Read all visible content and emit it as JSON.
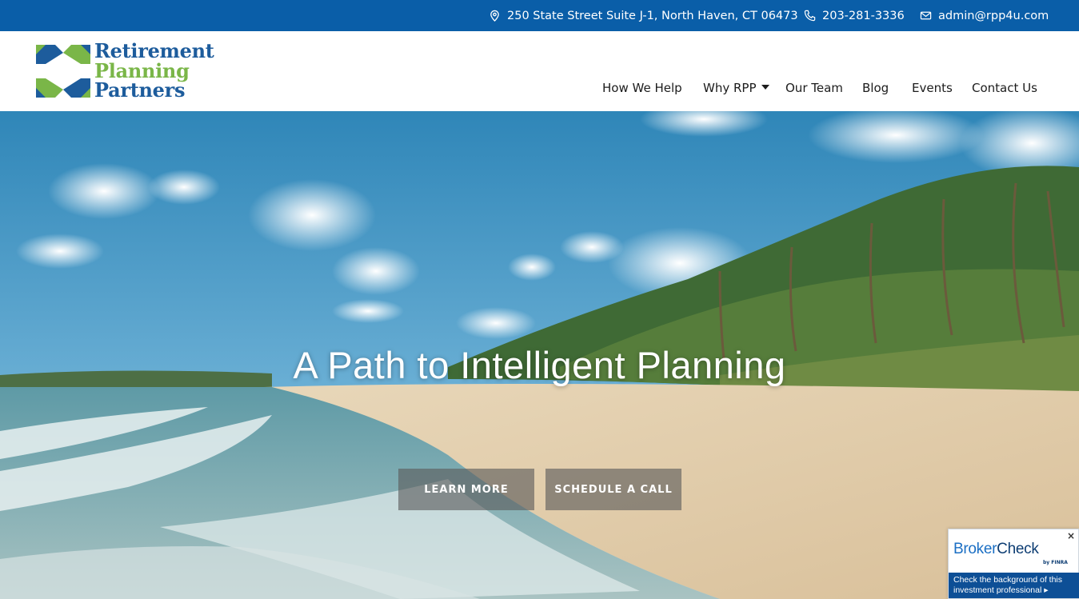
{
  "topbar": {
    "address": "250 State Street Suite J-1, North Haven, CT 06473",
    "phone": "203-281-3336",
    "email": "admin@rpp4u.com"
  },
  "logo": {
    "line1": "Retirement",
    "line2": "Planning",
    "line3": "Partners"
  },
  "nav": {
    "items": [
      {
        "label": "How We Help"
      },
      {
        "label": "Why RPP"
      },
      {
        "label": "Our Team"
      },
      {
        "label": "Blog"
      },
      {
        "label": "Events"
      },
      {
        "label": "Contact Us"
      }
    ]
  },
  "hero": {
    "title": "A Path to Intelligent Planning",
    "learn_more": "LEARN MORE",
    "schedule": "SCHEDULE A CALL"
  },
  "brokercheck": {
    "brand_a": "Broker",
    "brand_b": "Check",
    "by": "by FINRA",
    "text": "Check the background of this investment professional",
    "close": "×"
  },
  "colors": {
    "topbar": "#0a5ea8",
    "logo_blue": "#1d5c9c",
    "logo_green": "#7ab648"
  }
}
